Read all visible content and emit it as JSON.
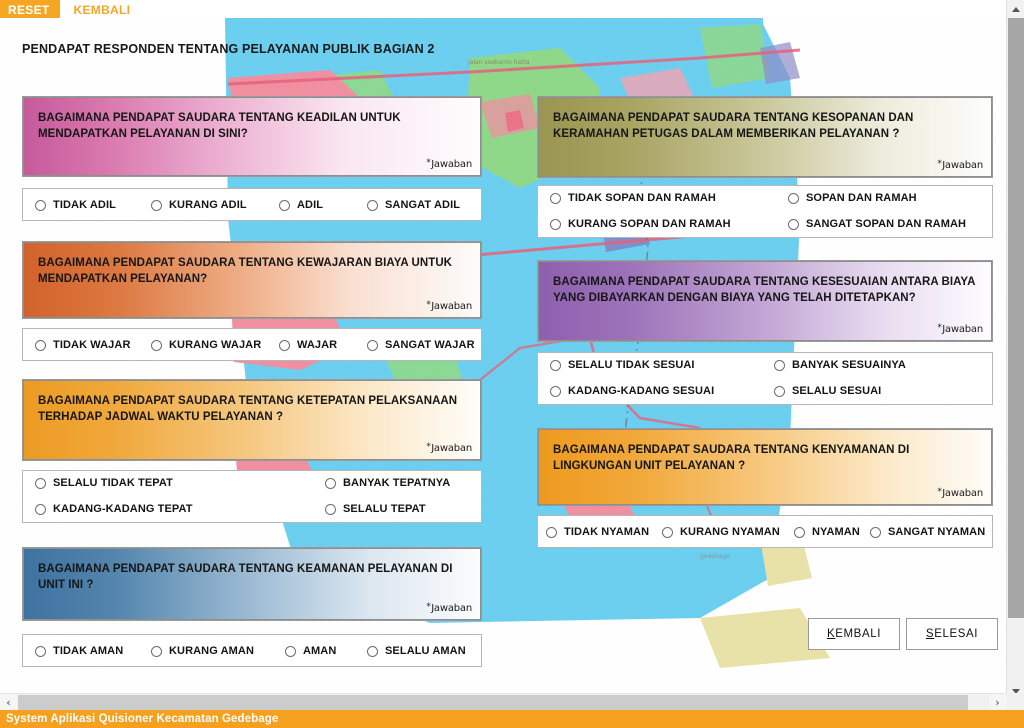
{
  "app": {
    "status_bar": "System Aplikasi Quisioner Kecamatan Gedebage",
    "page_title": "PENDAPAT RESPONDEN TENTANG PELAYANAN PUBLIK BAGIAN 2"
  },
  "topbar": {
    "reset_label": "RESET",
    "back_label": "KEMBALI",
    "reset_color": "#F5A623",
    "link_color": "#F5A623"
  },
  "answer_hint": {
    "star": "*",
    "text": "Jawaban"
  },
  "questions": [
    {
      "id": "keadilan",
      "text": "BAGAIMANA PENDAPAT SAUDARA TENTANG KEADILAN UNTUK MENDAPATKAN PELAYANAN DI SINI?",
      "gradient_start": "#C65A9B",
      "gradient_end": "#FEFDFD",
      "layout": "row4",
      "options": [
        "TIDAK ADIL",
        "KURANG ADIL",
        "ADIL",
        "SANGAT ADIL"
      ]
    },
    {
      "id": "kewajaran-biaya",
      "text": "BAGAIMANA PENDAPAT SAUDARA TENTANG KEWAJARAN BIAYA UNTUK MENDAPATKAN PELAYANAN?",
      "gradient_start": "#D2622B",
      "gradient_end": "#FDFBFA",
      "layout": "row4",
      "options": [
        "TIDAK WAJAR",
        "KURANG WAJAR",
        "WAJAR",
        "SANGAT WAJAR"
      ]
    },
    {
      "id": "ketepatan-jadwal",
      "text": "BAGAIMANA PENDAPAT SAUDARA TENTANG KETEPATAN PELAKSANAAN TERHADAP JADWAL WAKTU PELAYANAN ?",
      "gradient_start": "#EC9B22",
      "gradient_end": "#FEFDFA",
      "layout": "grid2x2",
      "options": [
        "SELALU TIDAK TEPAT",
        "BANYAK TEPATNYA",
        "KADANG-KADANG TEPAT",
        "SELALU TEPAT"
      ]
    },
    {
      "id": "keamanan",
      "text": "BAGAIMANA PENDAPAT SAUDARA TENTANG KEAMANAN PELAYANAN DI UNIT INI ?",
      "gradient_start": "#3E72A0",
      "gradient_end": "#FBFCFD",
      "layout": "row4",
      "options": [
        "TIDAK AMAN",
        "KURANG AMAN",
        "AMAN",
        "SELALU AMAN"
      ]
    },
    {
      "id": "kesopanan",
      "text": "BAGAIMANA PENDAPAT SAUDARA TENTANG KESOPANAN DAN KERAMAHAN PETUGAS DALAM MEMBERIKAN PELAYANAN ?",
      "gradient_start": "#9A9550",
      "gradient_end": "#FDFDFB",
      "layout": "grid2x2",
      "options": [
        "TIDAK SOPAN DAN RAMAH",
        "SOPAN DAN RAMAH",
        "KURANG SOPAN DAN RAMAH",
        "SANGAT SOPAN DAN RAMAH"
      ]
    },
    {
      "id": "kesesuaian-biaya",
      "text": "BAGAIMANA PENDAPAT SAUDARA TENTANG KESESUAIAN ANTARA BIAYA YANG DIBAYARKAN DENGAN BIAYA YANG TELAH DITETAPKAN?",
      "gradient_start": "#8E5FAF",
      "gradient_end": "#FDFCFE",
      "layout": "grid2x2",
      "options": [
        "SELALU TIDAK SESUAI",
        "BANYAK SESUAINYA",
        "KADANG-KADANG SESUAI",
        "SELALU SESUAI"
      ]
    },
    {
      "id": "kenyamanan",
      "text": "BAGAIMANA PENDAPAT SAUDARA TENTANG KENYAMANAN DI LINGKUNGAN UNIT PELAYANAN ?",
      "gradient_start": "#EE9A1F",
      "gradient_end": "#FEFDFA",
      "layout": "row4tight",
      "options": [
        "TIDAK NYAMAN",
        "KURANG NYAMAN",
        "NYAMAN",
        "SANGAT NYAMAN"
      ]
    }
  ],
  "nav_buttons": [
    {
      "id": "kembali",
      "accel": "K",
      "rest": "EMBALI"
    },
    {
      "id": "selesai",
      "accel": "S",
      "rest": "ELESAI"
    }
  ],
  "scrollbars": {
    "up_arrow": "▲",
    "down_arrow": "▼",
    "left_arrow": "‹",
    "right_arrow": "›"
  }
}
